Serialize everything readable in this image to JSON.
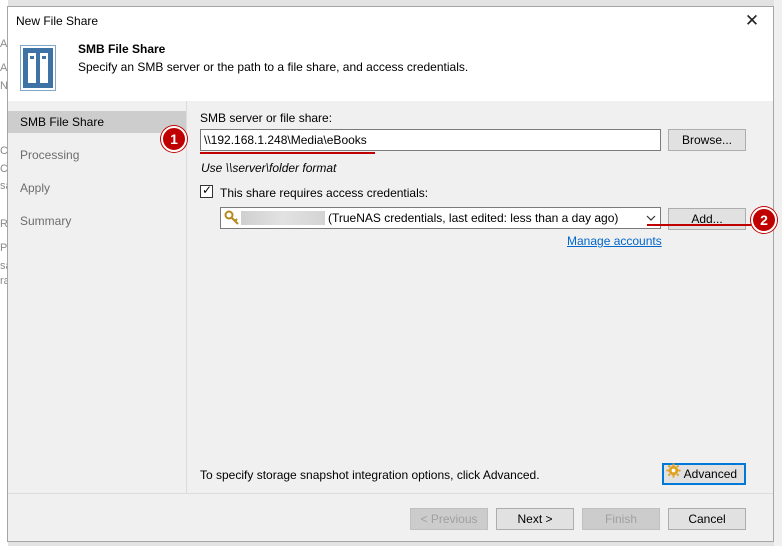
{
  "window": {
    "title": "New File Share",
    "close_glyph": "✕"
  },
  "header": {
    "title": "SMB File Share",
    "subtitle": "Specify an SMB server or the path to a file share, and access credentials."
  },
  "nav": {
    "items": [
      {
        "label": "SMB File Share",
        "active": true
      },
      {
        "label": "Processing",
        "active": false
      },
      {
        "label": "Apply",
        "active": false
      },
      {
        "label": "Summary",
        "active": false
      }
    ]
  },
  "form": {
    "server_label": "SMB server or file share:",
    "server_value": "\\\\192.168.1.248\\Media\\eBooks",
    "browse_label": "Browse...",
    "format_hint": "Use \\\\server\\folder format",
    "credentials_checkbox_label": "This share requires access credentials:",
    "credentials_checked": true,
    "credentials_selected": "(TrueNAS credentials, last edited: less than a day ago)",
    "add_label": "Add...",
    "manage_accounts_label": "Manage accounts",
    "advanced_note": "To specify storage snapshot integration options, click Advanced.",
    "advanced_label": "Advanced"
  },
  "footer": {
    "previous_label": "< Previous",
    "next_label": "Next >",
    "finish_label": "Finish",
    "cancel_label": "Cancel"
  },
  "annotations": {
    "marker1": "1",
    "marker2": "2",
    "color": "#c00000"
  },
  "background_fragments": [
    "Ac",
    "Ac",
    "N",
    "Cr",
    "Cr",
    "sa",
    "Re",
    "Pe",
    "sa",
    "ra"
  ],
  "icons": {
    "header": "file-share-icon",
    "credentials": "key-icon",
    "dropdown": "chevron-down-icon",
    "advanced": "gear-icon",
    "close": "close-icon"
  }
}
